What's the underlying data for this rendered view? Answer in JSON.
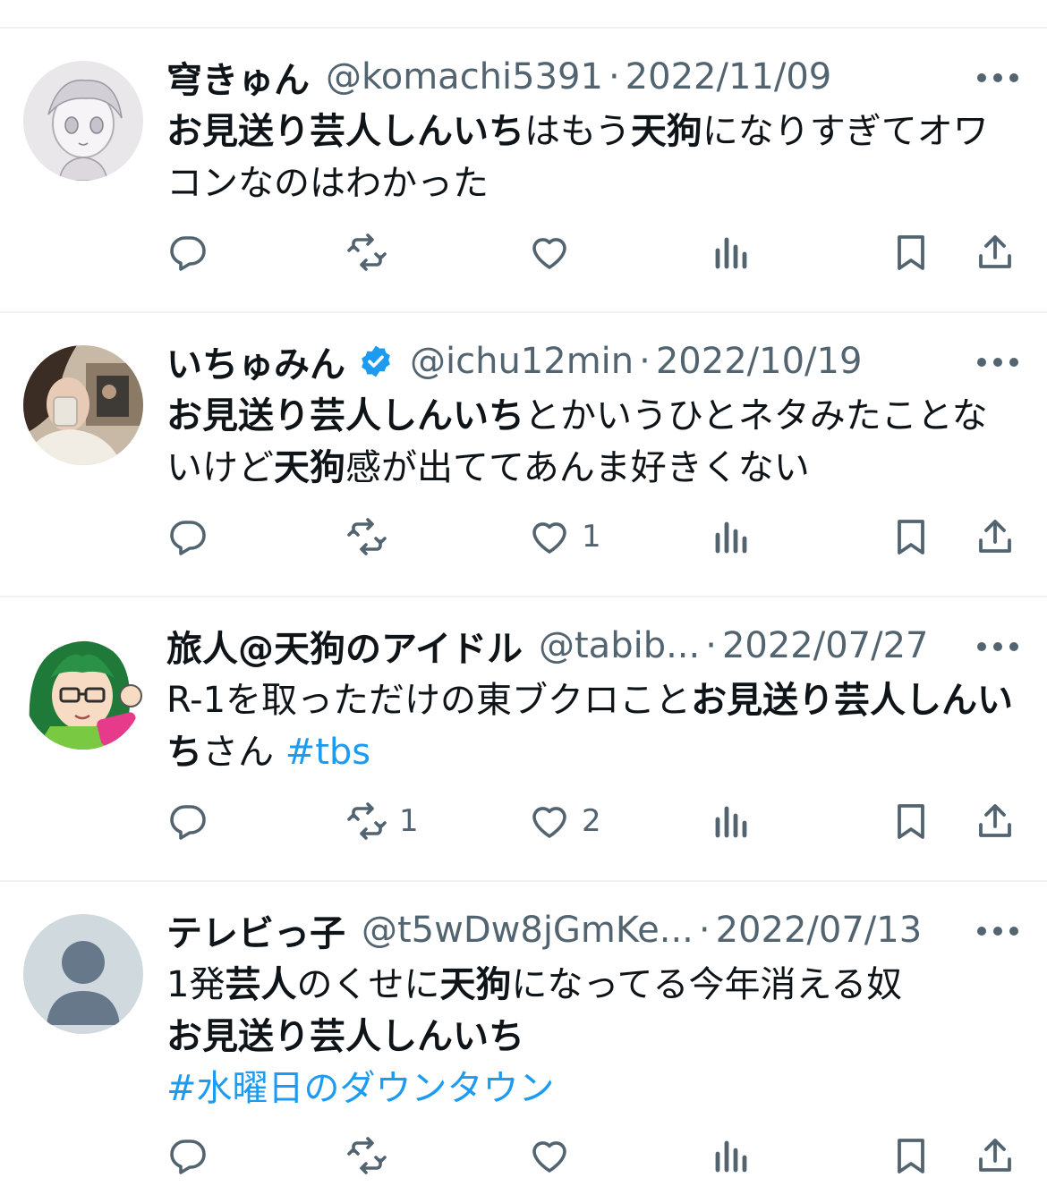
{
  "tweets": [
    {
      "name": "穹きゅん",
      "handle": "@komachi5391",
      "date": "2022/11/09",
      "verified": false,
      "body": [
        {
          "t": "お見送り芸人しんいち",
          "b": true
        },
        {
          "t": "はもう"
        },
        {
          "t": "天狗",
          "b": true
        },
        {
          "t": "になりすぎてオワコンなのはわかった"
        }
      ],
      "reply_count": "",
      "retweet_count": "",
      "like_count": ""
    },
    {
      "name": "いちゅみん",
      "handle": "@ichu12min",
      "date": "2022/10/19",
      "verified": true,
      "body": [
        {
          "t": "お見送り芸人しんいち",
          "b": true
        },
        {
          "t": "とかいうひとネタみたことないけど"
        },
        {
          "t": "天狗",
          "b": true
        },
        {
          "t": "感が出ててあんま好きくない"
        }
      ],
      "reply_count": "",
      "retweet_count": "",
      "like_count": "1"
    },
    {
      "name": "旅人@天狗のアイドル",
      "handle": "@tabib...",
      "date": "2022/07/27",
      "verified": false,
      "body": [
        {
          "t": "R-1を取っただけの東ブクロこと"
        },
        {
          "t": "お見送り芸人しんいち",
          "b": true
        },
        {
          "t": "さん "
        },
        {
          "t": "#tbs",
          "tag": true
        }
      ],
      "reply_count": "",
      "retweet_count": "1",
      "like_count": "2"
    },
    {
      "name": "テレビっ子",
      "handle": "@t5wDw8jGmKe...",
      "date": "2022/07/13",
      "verified": false,
      "body": [
        {
          "t": "1発"
        },
        {
          "t": "芸人",
          "b": true
        },
        {
          "t": "のくせに"
        },
        {
          "t": "天狗",
          "b": true
        },
        {
          "t": "になってる今年消える奴"
        },
        {
          "br": true
        },
        {
          "t": "お見送り芸人しんいち",
          "b": true
        },
        {
          "br": true
        },
        {
          "t": "#水曜日のダウンタウン",
          "tag": true
        }
      ],
      "reply_count": "",
      "retweet_count": "",
      "like_count": ""
    }
  ],
  "colors": {
    "text": "#0f1419",
    "secondary": "#536471",
    "link": "#1d9bf0",
    "verified": "#1d9bf0",
    "divider": "#eff3f4"
  },
  "icons": [
    "reply-icon",
    "retweet-icon",
    "like-icon",
    "views-icon",
    "bookmark-icon",
    "share-icon",
    "more-icon",
    "verified-icon"
  ]
}
